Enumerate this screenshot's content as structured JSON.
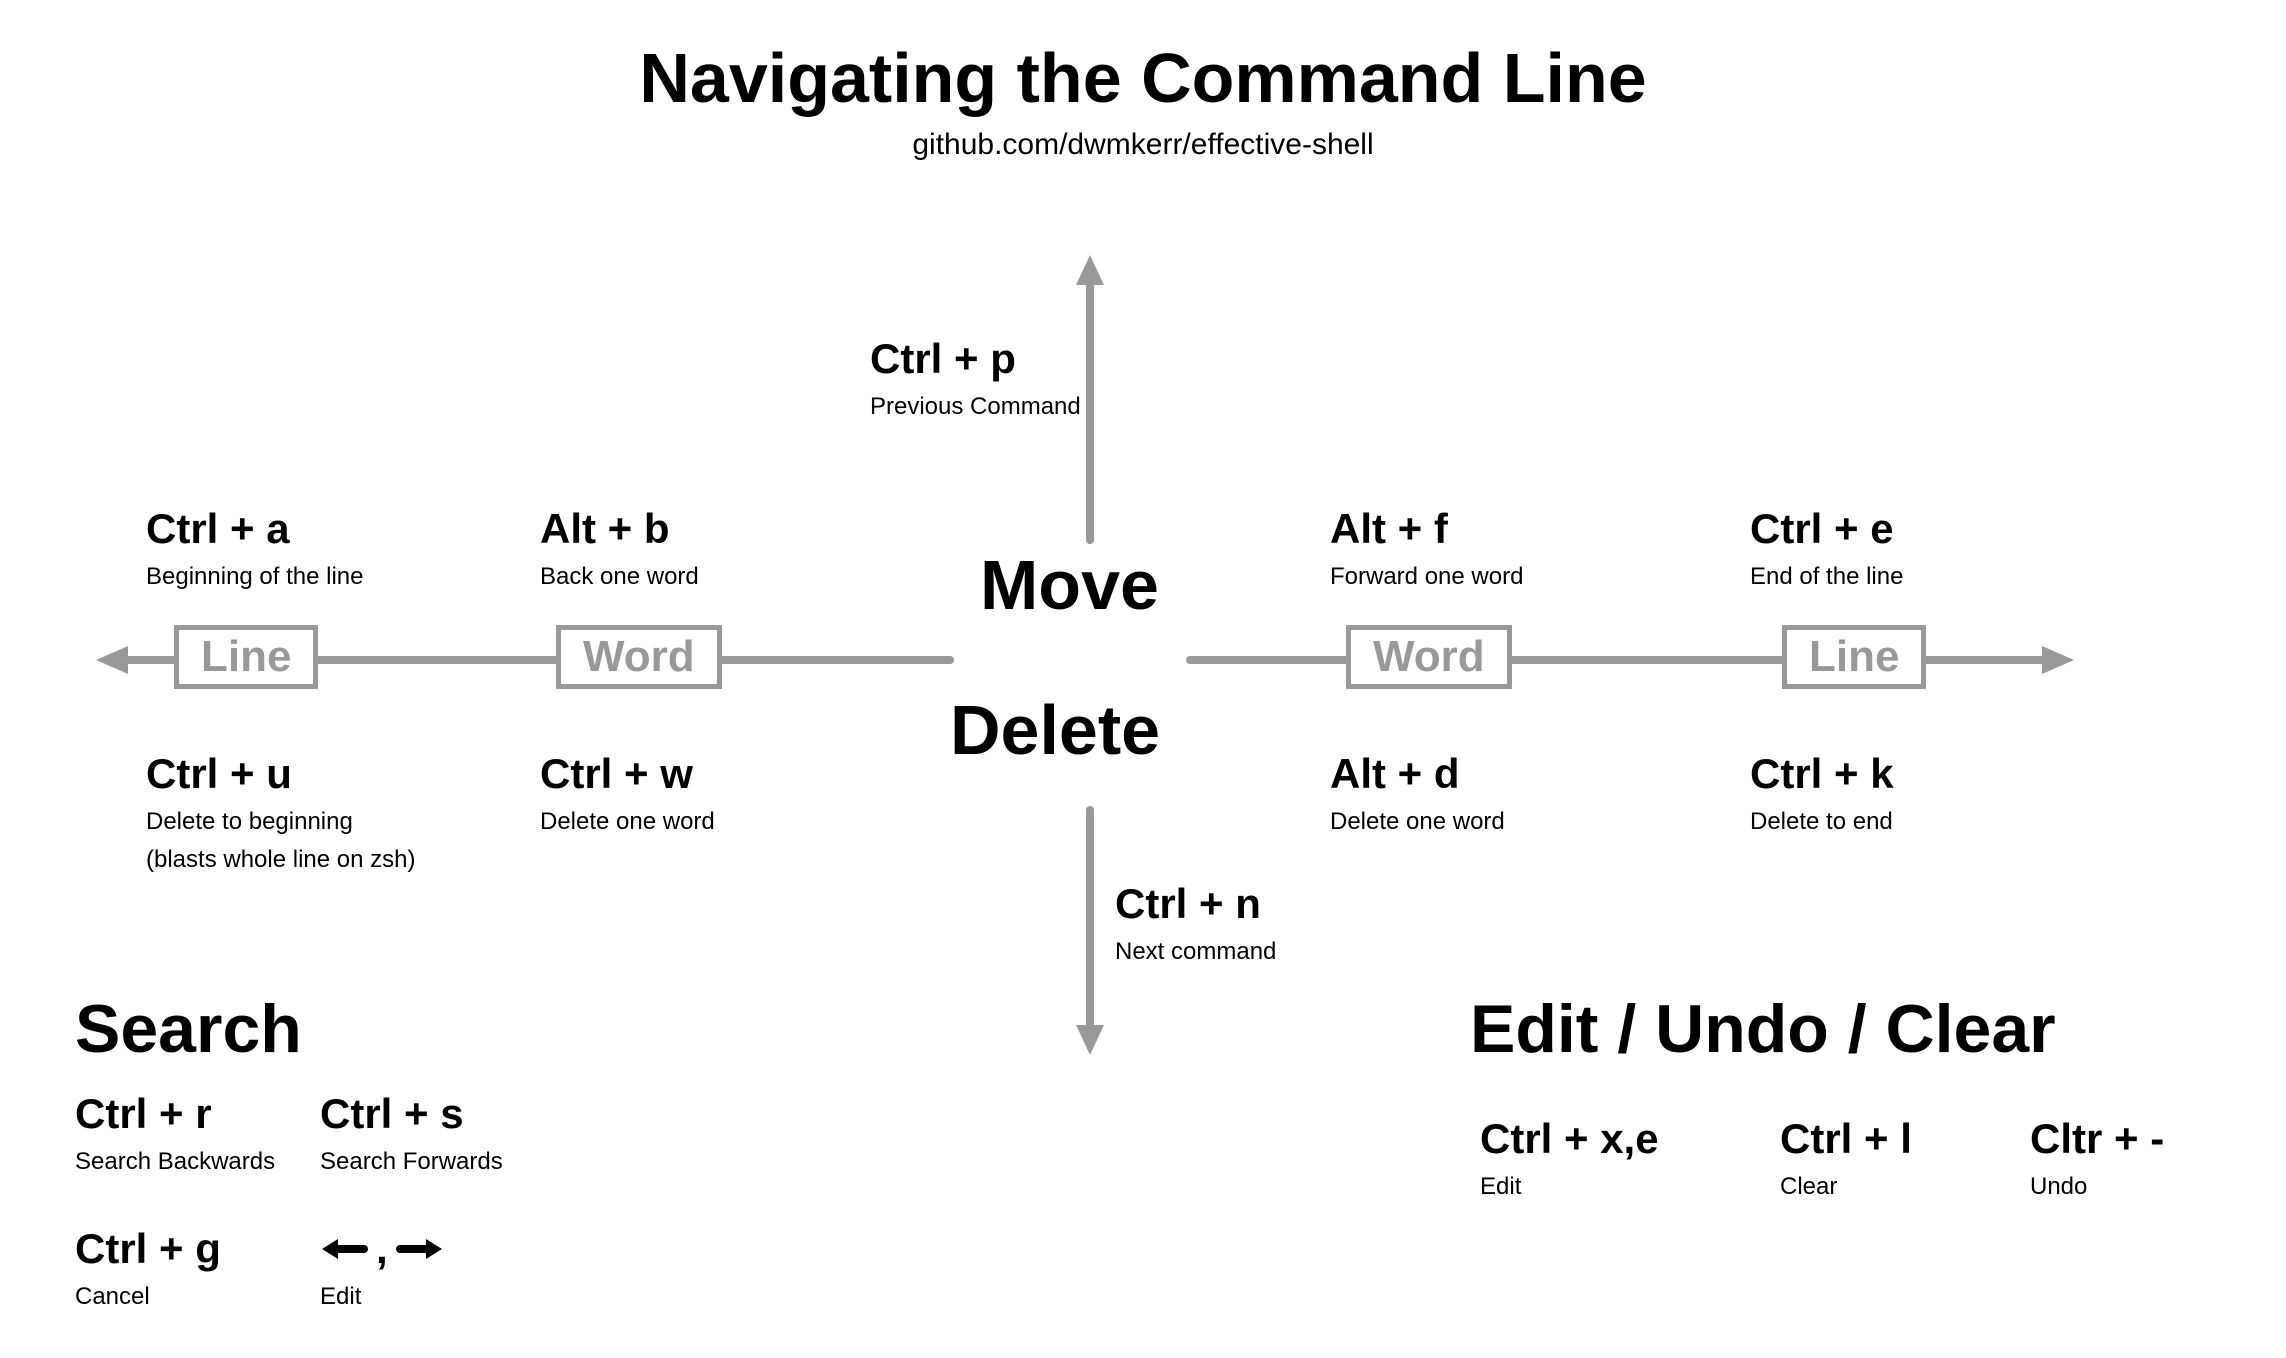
{
  "header": {
    "title": "Navigating the Command Line",
    "subtitle": "github.com/dwmkerr/effective-shell"
  },
  "center": {
    "move": "Move",
    "delete": "Delete"
  },
  "axis_labels": {
    "left_line": "Line",
    "left_word": "Word",
    "right_word": "Word",
    "right_line": "Line"
  },
  "move_shortcuts": {
    "ctrl_p": {
      "key": "Ctrl + p",
      "desc": "Previous Command"
    },
    "ctrl_n": {
      "key": "Ctrl + n",
      "desc": "Next command"
    },
    "ctrl_a": {
      "key": "Ctrl + a",
      "desc": "Beginning of the line"
    },
    "alt_b": {
      "key": "Alt + b",
      "desc": "Back one word"
    },
    "alt_f": {
      "key": "Alt + f",
      "desc": "Forward one word"
    },
    "ctrl_e": {
      "key": "Ctrl + e",
      "desc": "End of the line"
    }
  },
  "delete_shortcuts": {
    "ctrl_u": {
      "key": "Ctrl + u",
      "desc": "Delete to beginning",
      "desc2": "(blasts whole line on zsh)"
    },
    "ctrl_w": {
      "key": "Ctrl + w",
      "desc": "Delete one word"
    },
    "alt_d": {
      "key": "Alt + d",
      "desc": "Delete one word"
    },
    "ctrl_k": {
      "key": "Ctrl + k",
      "desc": "Delete to end"
    }
  },
  "sections": {
    "search_heading": "Search",
    "edit_heading": "Edit / Undo / Clear"
  },
  "search_shortcuts": {
    "ctrl_r": {
      "key": "Ctrl + r",
      "desc": "Search Backwards"
    },
    "ctrl_s": {
      "key": "Ctrl + s",
      "desc": "Search Forwards"
    },
    "ctrl_g": {
      "key": "Ctrl + g",
      "desc": "Cancel"
    },
    "arrows": {
      "comma": ",",
      "desc": "Edit"
    }
  },
  "edit_shortcuts": {
    "ctrl_xe": {
      "key": "Ctrl + x,e",
      "desc": "Edit"
    },
    "ctrl_l": {
      "key": "Ctrl + l",
      "desc": "Clear"
    },
    "ctrl_dash": {
      "key": "Cltr + -",
      "desc": "Undo"
    }
  }
}
